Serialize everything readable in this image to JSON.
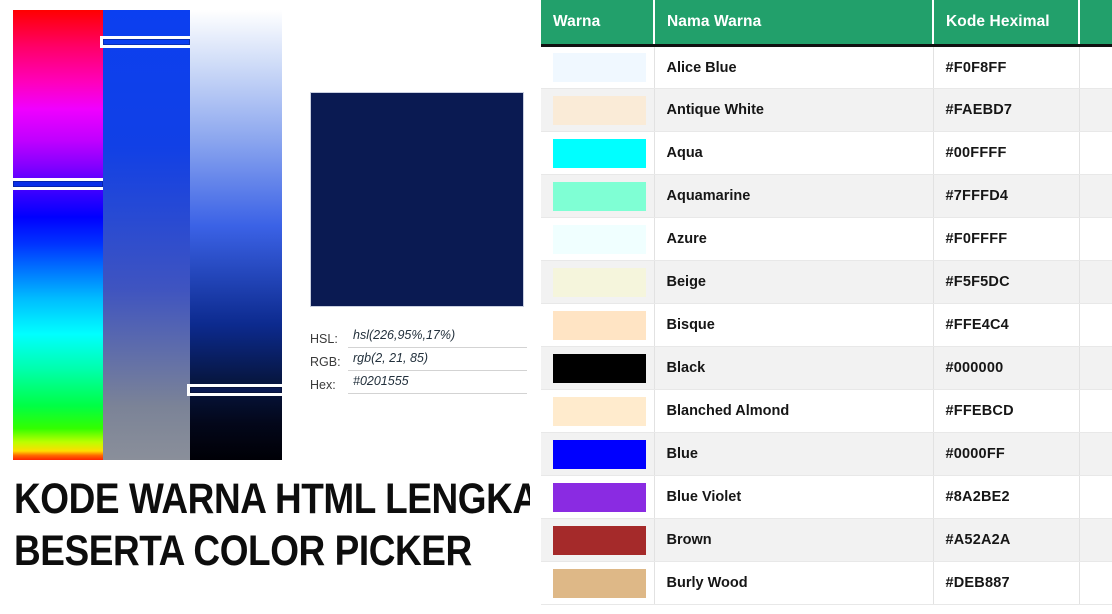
{
  "headline": {
    "line1": "KODE WARNA HTML LENGKAP",
    "line2": "BESERTA COLOR PICKER"
  },
  "picker": {
    "hue_strip": {
      "name": "hue-gradient-strip",
      "marker_position_pct": 37.3
    },
    "saturation_strip": {
      "name": "saturation-gradient-strip",
      "marker_position_pct": 5.8
    },
    "lightness_strip": {
      "name": "lightness-gradient-strip",
      "marker_position_pct": 83.0
    },
    "preview_color": "#0a1a52",
    "readouts": [
      {
        "label": "HSL:",
        "value": "hsl(226,95%,17%)"
      },
      {
        "label": "RGB:",
        "value": "rgb(2, 21, 85)"
      },
      {
        "label": "Hex:",
        "value": "#0201555"
      }
    ]
  },
  "table": {
    "accent_header_color": "#22a06b",
    "headers": [
      "Warna",
      "Nama Warna",
      "Kode Heximal",
      ""
    ],
    "rows": [
      {
        "swatch": "#F0F8FF",
        "name": "Alice Blue",
        "hex": "#F0F8FF"
      },
      {
        "swatch": "#FAEBD7",
        "name": "Antique White",
        "hex": "#FAEBD7"
      },
      {
        "swatch": "#00FFFF",
        "name": "Aqua",
        "hex": "#00FFFF"
      },
      {
        "swatch": "#7FFFD4",
        "name": "Aquamarine",
        "hex": "#7FFFD4"
      },
      {
        "swatch": "#F0FFFF",
        "name": "Azure",
        "hex": "#F0FFFF"
      },
      {
        "swatch": "#F5F5DC",
        "name": "Beige",
        "hex": "#F5F5DC"
      },
      {
        "swatch": "#FFE4C4",
        "name": "Bisque",
        "hex": "#FFE4C4"
      },
      {
        "swatch": "#000000",
        "name": "Black",
        "hex": "#000000"
      },
      {
        "swatch": "#FFEBCD",
        "name": "Blanched Almond",
        "hex": "#FFEBCD"
      },
      {
        "swatch": "#0000FF",
        "name": "Blue",
        "hex": "#0000FF"
      },
      {
        "swatch": "#8A2BE2",
        "name": "Blue Violet",
        "hex": "#8A2BE2"
      },
      {
        "swatch": "#A52A2A",
        "name": "Brown",
        "hex": "#A52A2A"
      },
      {
        "swatch": "#DEB887",
        "name": "Burly Wood",
        "hex": "#DEB887"
      }
    ]
  }
}
